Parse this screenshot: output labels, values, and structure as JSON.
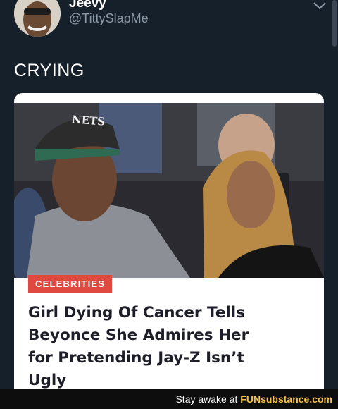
{
  "tweet": {
    "display_name": "Jeevy",
    "handle": "@TittySlapMe",
    "text": "CRYING",
    "avatar_icon": "user-avatar",
    "menu_icon": "chevron-down-icon"
  },
  "card": {
    "category": "CELEBRITIES",
    "headline_lines": [
      "Girl Dying Of Cancer Tells",
      "Beyonce She Admires Her",
      "for Pretending Jay-Z Isn’t",
      "Ugly"
    ],
    "cap_text": "NETS",
    "badge_color": "#e0493f"
  },
  "watermark": {
    "prefix": "Stay awake at",
    "brand": "FUNsubstance.com"
  }
}
